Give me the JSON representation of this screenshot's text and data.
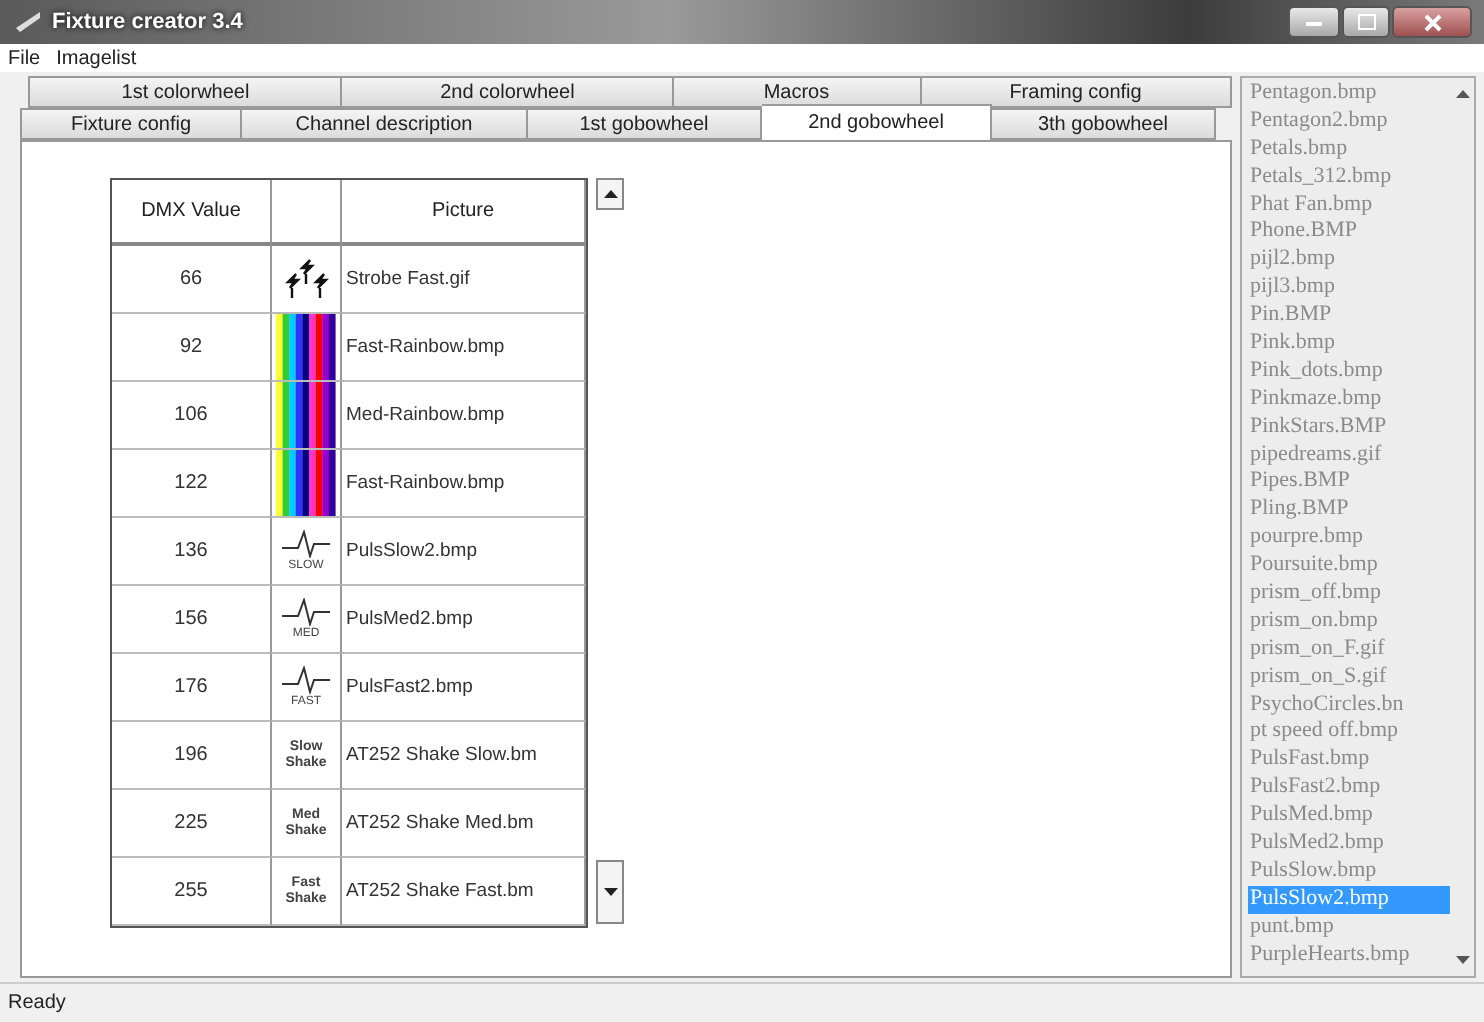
{
  "window": {
    "title": "Fixture creator 3.4"
  },
  "menu": [
    "File",
    "Imagelist"
  ],
  "tab_rows": [
    [
      {
        "label": "1st colorwheel",
        "selected": false
      },
      {
        "label": "2nd colorwheel",
        "selected": false
      },
      {
        "label": "Macros",
        "selected": false
      },
      {
        "label": "Framing config",
        "selected": false
      }
    ],
    [
      {
        "label": "Fixture config",
        "selected": false
      },
      {
        "label": "Channel description",
        "selected": false
      },
      {
        "label": "1st gobowheel",
        "selected": false
      },
      {
        "label": "2nd gobowheel",
        "selected": true
      },
      {
        "label": "3th gobowheel",
        "selected": false
      }
    ]
  ],
  "table": {
    "columns": [
      "DMX Value",
      "",
      "Picture"
    ],
    "rows": [
      {
        "dmx": "66",
        "icon": {
          "kind": "strobe"
        },
        "picture": "Strobe Fast.gif"
      },
      {
        "dmx": "92",
        "icon": {
          "kind": "rainbow"
        },
        "picture": "Fast-Rainbow.bmp"
      },
      {
        "dmx": "106",
        "icon": {
          "kind": "rainbow"
        },
        "picture": "Med-Rainbow.bmp"
      },
      {
        "dmx": "122",
        "icon": {
          "kind": "rainbow"
        },
        "picture": "Fast-Rainbow.bmp"
      },
      {
        "dmx": "136",
        "icon": {
          "kind": "pulse",
          "label": "SLOW"
        },
        "picture": "PulsSlow2.bmp"
      },
      {
        "dmx": "156",
        "icon": {
          "kind": "pulse",
          "label": "MED"
        },
        "picture": "PulsMed2.bmp"
      },
      {
        "dmx": "176",
        "icon": {
          "kind": "pulse",
          "label": "FAST"
        },
        "picture": "PulsFast2.bmp"
      },
      {
        "dmx": "196",
        "icon": {
          "kind": "shake",
          "label": "Slow Shake"
        },
        "picture": "AT252 Shake Slow.bm"
      },
      {
        "dmx": "225",
        "icon": {
          "kind": "shake",
          "label": "Med Shake"
        },
        "picture": "AT252 Shake Med.bm"
      },
      {
        "dmx": "255",
        "icon": {
          "kind": "shake",
          "label": "Fast Shake"
        },
        "picture": "AT252 Shake Fast.bm"
      }
    ]
  },
  "image_list": [
    {
      "name": "Pentagon.bmp",
      "selected": false
    },
    {
      "name": "Pentagon2.bmp",
      "selected": false
    },
    {
      "name": "Petals.bmp",
      "selected": false
    },
    {
      "name": "Petals_312.bmp",
      "selected": false
    },
    {
      "name": "Phat Fan.bmp",
      "selected": false
    },
    {
      "name": "Phone.BMP",
      "selected": false
    },
    {
      "name": "pijl2.bmp",
      "selected": false
    },
    {
      "name": "pijl3.bmp",
      "selected": false
    },
    {
      "name": "Pin.BMP",
      "selected": false
    },
    {
      "name": "Pink.bmp",
      "selected": false
    },
    {
      "name": "Pink_dots.bmp",
      "selected": false
    },
    {
      "name": "Pinkmaze.bmp",
      "selected": false
    },
    {
      "name": "PinkStars.BMP",
      "selected": false
    },
    {
      "name": "pipedreams.gif",
      "selected": false
    },
    {
      "name": "Pipes.BMP",
      "selected": false
    },
    {
      "name": "Pling.BMP",
      "selected": false
    },
    {
      "name": "pourpre.bmp",
      "selected": false
    },
    {
      "name": "Poursuite.bmp",
      "selected": false
    },
    {
      "name": "prism_off.bmp",
      "selected": false
    },
    {
      "name": "prism_on.bmp",
      "selected": false
    },
    {
      "name": "prism_on_F.gif",
      "selected": false
    },
    {
      "name": "prism_on_S.gif",
      "selected": false
    },
    {
      "name": "PsychoCircles.bn",
      "selected": false
    },
    {
      "name": "pt speed off.bmp",
      "selected": false
    },
    {
      "name": "PulsFast.bmp",
      "selected": false
    },
    {
      "name": "PulsFast2.bmp",
      "selected": false
    },
    {
      "name": "PulsMed.bmp",
      "selected": false
    },
    {
      "name": "PulsMed2.bmp",
      "selected": false
    },
    {
      "name": "PulsSlow.bmp",
      "selected": false
    },
    {
      "name": "PulsSlow2.bmp",
      "selected": true
    },
    {
      "name": "punt.bmp",
      "selected": false
    },
    {
      "name": "PurpleHearts.bmp",
      "selected": false
    }
  ],
  "status_bar": "Ready"
}
